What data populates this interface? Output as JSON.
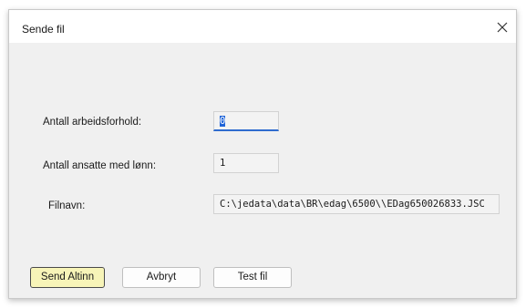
{
  "dialog": {
    "title": "Sende fil",
    "close_icon": "close-icon"
  },
  "form": {
    "antall_arbeidsforhold": {
      "label": "Antall arbeidsforhold:",
      "value": "0"
    },
    "antall_ansatte": {
      "label": "Antall ansatte med lønn:",
      "value": "1"
    },
    "filnavn": {
      "label": "Filnavn:",
      "value": "C:\\jedata\\data\\BR\\edag\\6500\\\\EDag650026833.JSC"
    }
  },
  "buttons": {
    "send_altinn": "Send Altinn",
    "avbryt": "Avbryt",
    "test_fil": "Test fil"
  },
  "colors": {
    "highlight": "#f4f03c",
    "focus_accent": "#2f6ccf"
  }
}
